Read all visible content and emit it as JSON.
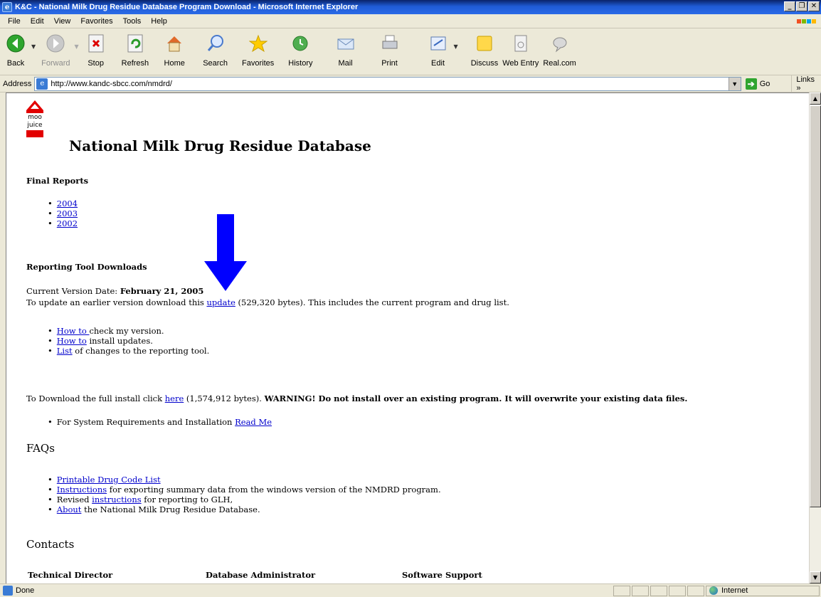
{
  "window": {
    "title": "K&C - National Milk Drug Residue Database Program Download - Microsoft Internet Explorer",
    "minimize": "_",
    "restore": "❐",
    "close": "✕"
  },
  "menu": {
    "items": [
      {
        "label": "File"
      },
      {
        "label": "Edit"
      },
      {
        "label": "View"
      },
      {
        "label": "Favorites"
      },
      {
        "label": "Tools"
      },
      {
        "label": "Help"
      }
    ]
  },
  "toolbar": {
    "back": "Back",
    "forward": "Forward",
    "stop": "Stop",
    "refresh": "Refresh",
    "home": "Home",
    "search": "Search",
    "favorites": "Favorites",
    "history": "History",
    "mail": "Mail",
    "print": "Print",
    "edit": "Edit",
    "discuss": "Discuss",
    "web_entry": "Web Entry",
    "real": "Real.com"
  },
  "address": {
    "label": "Address",
    "url": "http://www.kandc-sbcc.com/nmdrd/",
    "go": "Go",
    "links": "Links »"
  },
  "page": {
    "logo_text_1": "moo",
    "logo_text_2": "juice",
    "title": "National Milk Drug Residue Database",
    "final_reports": {
      "heading": "Final Reports",
      "items": [
        "2004",
        "2003",
        "2002"
      ]
    },
    "reporting": {
      "heading": "Reporting Tool Downloads",
      "version_label": "Current Version Date: ",
      "version_date": "February 21, 2005",
      "update_pre": "To update an earlier version download this ",
      "update_link": "update",
      "update_post": " (529,320 bytes). This includes the current program and drug list.",
      "items": [
        {
          "link": "How to ",
          "text": "check my version."
        },
        {
          "link": "How to",
          "text": " install updates."
        },
        {
          "link": "List",
          "text": " of changes to the reporting tool."
        }
      ]
    },
    "full_install": {
      "pre": "To Download the full install click ",
      "link": "here",
      "mid": " (1,574,912 bytes). ",
      "warning": "WARNING! Do not install over an existing program. It will overwrite your existing data files.",
      "req_text": "For System Requirements and Installation ",
      "req_link": "Read Me"
    },
    "faqs": {
      "heading": "FAQs",
      "items": [
        {
          "pre": "",
          "link": "Printable Drug Code List",
          "post": ""
        },
        {
          "pre": "",
          "link": "Instructions",
          "post": " for exporting summary data from the windows version of the NMDRD program."
        },
        {
          "pre": "Revised ",
          "link": "instructions",
          "post": " for reporting to GLH,"
        },
        {
          "pre": "",
          "link": "About",
          "post": " the National Milk Drug Residue Database."
        }
      ]
    },
    "contacts": {
      "heading": "Contacts",
      "technical": "Technical Director",
      "dbadmin": "Database Administrator",
      "software": "Software Support"
    }
  },
  "status": {
    "text": "Done",
    "zone": "Internet"
  },
  "colors": {
    "link": "#0000cc",
    "arrow": "#0000ff",
    "logo_red": "#e20000"
  }
}
